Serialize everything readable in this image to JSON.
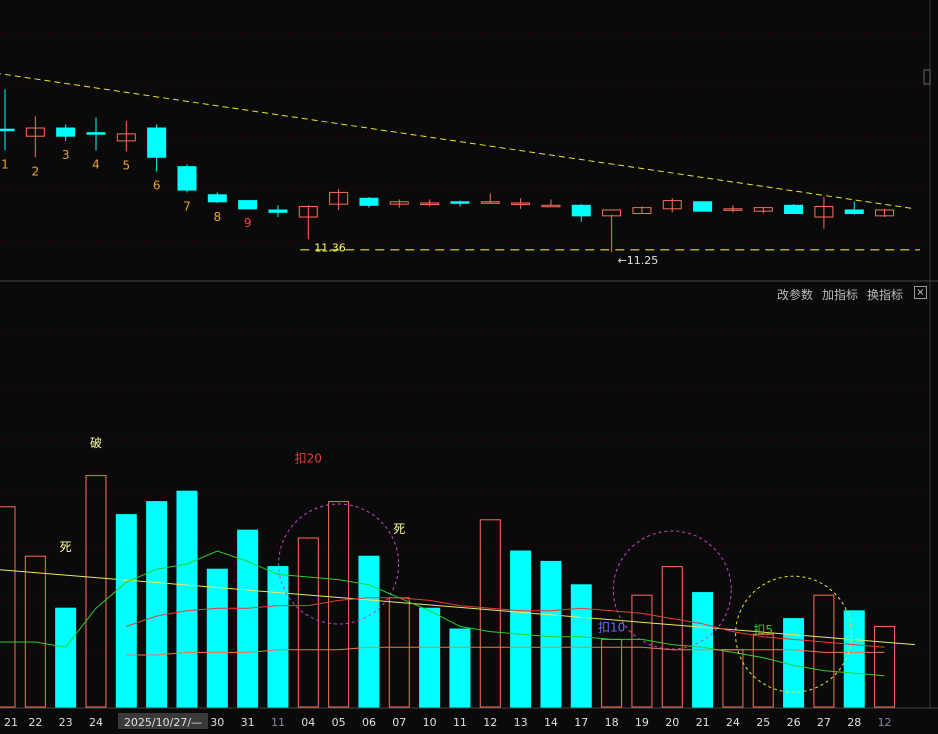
{
  "toolbar": {
    "params_label": "改参数",
    "add_indicator_label": "加指标",
    "switch_indicator_label": "换指标",
    "close_symbol": "×"
  },
  "colors": {
    "background": "#0a0a0a",
    "up": "#ff6f5b",
    "down": "#00ffff",
    "trendline_price": "#e6e62e",
    "trendline_volume": "#e8e860",
    "ma_green": "#2ecc2e",
    "ma_red": "#e63c3c",
    "ma_orange": "#e67a50",
    "grid": "#3a0000"
  },
  "chart_data": [
    {
      "type": "candlestick",
      "panel": "price",
      "candles": [
        {
          "o": 12.3,
          "h": 12.64,
          "l": 12.12,
          "c": 12.29
        },
        {
          "o": 12.24,
          "h": 12.41,
          "l": 12.06,
          "c": 12.31
        },
        {
          "o": 12.31,
          "h": 12.34,
          "l": 12.2,
          "c": 12.24
        },
        {
          "o": 12.27,
          "h": 12.4,
          "l": 12.12,
          "c": 12.26
        },
        {
          "o": 12.2,
          "h": 12.37,
          "l": 12.11,
          "c": 12.26
        },
        {
          "o": 12.31,
          "h": 12.34,
          "l": 11.94,
          "c": 12.06
        },
        {
          "o": 11.98,
          "h": 12.0,
          "l": 11.76,
          "c": 11.78
        },
        {
          "o": 11.74,
          "h": 11.76,
          "l": 11.67,
          "c": 11.68
        },
        {
          "o": 11.69,
          "h": 11.69,
          "l": 11.62,
          "c": 11.62
        },
        {
          "o": 11.61,
          "h": 11.65,
          "l": 11.55,
          "c": 11.59
        },
        {
          "o": 11.55,
          "h": 11.65,
          "l": 11.36,
          "c": 11.64
        },
        {
          "o": 11.66,
          "h": 11.79,
          "l": 11.61,
          "c": 11.76
        },
        {
          "o": 11.71,
          "h": 11.72,
          "l": 11.63,
          "c": 11.65
        },
        {
          "o": 11.66,
          "h": 11.7,
          "l": 11.63,
          "c": 11.68
        },
        {
          "o": 11.66,
          "h": 11.7,
          "l": 11.64,
          "c": 11.67
        },
        {
          "o": 11.68,
          "h": 11.69,
          "l": 11.64,
          "c": 11.67
        },
        {
          "o": 11.68,
          "h": 11.75,
          "l": 11.67,
          "c": 11.68
        },
        {
          "o": 11.67,
          "h": 11.71,
          "l": 11.62,
          "c": 11.67
        },
        {
          "o": 11.65,
          "h": 11.7,
          "l": 11.65,
          "c": 11.65
        },
        {
          "o": 11.65,
          "h": 11.66,
          "l": 11.51,
          "c": 11.56
        },
        {
          "o": 11.56,
          "h": 11.57,
          "l": 11.25,
          "c": 11.61
        },
        {
          "o": 11.58,
          "h": 11.64,
          "l": 11.58,
          "c": 11.63
        },
        {
          "o": 11.62,
          "h": 11.71,
          "l": 11.59,
          "c": 11.69
        },
        {
          "o": 11.68,
          "h": 11.68,
          "l": 11.6,
          "c": 11.6
        },
        {
          "o": 11.62,
          "h": 11.65,
          "l": 11.59,
          "c": 11.62
        },
        {
          "o": 11.6,
          "h": 11.63,
          "l": 11.58,
          "c": 11.63
        },
        {
          "o": 11.65,
          "h": 11.66,
          "l": 11.58,
          "c": 11.58
        },
        {
          "o": 11.55,
          "h": 11.72,
          "l": 11.45,
          "c": 11.64
        },
        {
          "o": 11.61,
          "h": 11.68,
          "l": 11.57,
          "c": 11.58
        },
        {
          "o": 11.56,
          "h": 11.62,
          "l": 11.55,
          "c": 11.61
        }
      ],
      "trendline": [
        [
          0,
          12.78
        ],
        [
          30,
          11.62
        ]
      ],
      "support": {
        "from": 10,
        "to": 30,
        "value": 11.27
      },
      "count_labels": [
        {
          "index": 0,
          "text": "1"
        },
        {
          "index": 1,
          "text": "2"
        },
        {
          "index": 2,
          "text": "3"
        },
        {
          "index": 3,
          "text": "4"
        },
        {
          "index": 4,
          "text": "5"
        },
        {
          "index": 5,
          "text": "6"
        },
        {
          "index": 6,
          "text": "7"
        },
        {
          "index": 7,
          "text": "8"
        },
        {
          "index": 8,
          "text": "9"
        }
      ],
      "annotations": [
        {
          "index": 10,
          "value": 11.36,
          "text": "11.36"
        },
        {
          "index": 20,
          "value": 11.25,
          "text": "←11.25"
        }
      ]
    },
    {
      "type": "bar",
      "panel": "volume",
      "dates": [
        "21",
        "22",
        "23",
        "24",
        "2025/10/27/—",
        "30",
        "31",
        "11",
        "04",
        "05",
        "06",
        "07",
        "10",
        "11",
        "12",
        "13",
        "14",
        "17",
        "18",
        "19",
        "20",
        "21",
        "24",
        "25",
        "26",
        "27",
        "28",
        "12"
      ],
      "volumes": [
        77,
        58,
        38,
        89,
        74,
        79,
        83,
        53,
        68,
        54,
        65,
        79,
        58,
        42,
        38,
        30,
        72,
        60,
        56,
        47,
        26,
        43,
        54,
        44,
        22,
        28,
        34,
        43,
        37,
        31
      ],
      "direction": [
        "up",
        "up",
        "down",
        "up",
        "down",
        "down",
        "down",
        "down",
        "down",
        "down",
        "up",
        "up",
        "down",
        "up",
        "down",
        "down",
        "up",
        "down",
        "down",
        "down",
        "up",
        "up",
        "up",
        "down",
        "up",
        "up",
        "down",
        "up",
        "down",
        "up"
      ],
      "trendline": [
        [
          0,
          52
        ],
        [
          30,
          24
        ]
      ],
      "ma_lines": [
        {
          "color": "green",
          "values": [
            25,
            25,
            23,
            38,
            48,
            53,
            55,
            60,
            56,
            51,
            50,
            49,
            47,
            42,
            37,
            31,
            29,
            28,
            27,
            27,
            26,
            26,
            24,
            23,
            21,
            19,
            16,
            14,
            13,
            12
          ]
        },
        {
          "color": "red",
          "values": [
            null,
            null,
            null,
            null,
            31,
            35,
            37,
            38,
            38,
            39,
            39,
            41,
            42,
            42,
            41,
            39,
            38,
            37,
            37,
            38,
            37,
            36,
            34,
            32,
            29,
            27,
            26,
            25,
            24,
            23
          ]
        },
        {
          "color": "orange",
          "values": [
            null,
            null,
            null,
            null,
            20,
            20,
            21,
            21,
            21,
            22,
            22,
            22,
            23,
            23,
            23,
            23,
            23,
            23,
            23,
            23,
            23,
            23,
            22,
            22,
            22,
            22,
            22,
            21,
            21,
            21
          ]
        }
      ],
      "labels": [
        {
          "index": 3,
          "value": 100,
          "text": "破",
          "color": "#ffffa0"
        },
        {
          "index": 10,
          "value": 94,
          "text": "扣20",
          "color": "#e63c3c"
        },
        {
          "index": 2,
          "value": 60,
          "text": "死",
          "color": "#ffffa0"
        },
        {
          "index": 13,
          "value": 67,
          "text": "死",
          "color": "#ffffa0"
        },
        {
          "index": 20,
          "value": 29,
          "text": "扣10",
          "color": "#6a6aff"
        },
        {
          "index": 25,
          "value": 28,
          "text": "扣5",
          "color": "#2ecc2e"
        }
      ],
      "circles": [
        {
          "index": 11,
          "value": 55,
          "r": 60,
          "color": "#cc44cc"
        },
        {
          "index": 22,
          "value": 45,
          "r": 59,
          "color": "#cc44cc"
        },
        {
          "index": 26,
          "value": 28,
          "r": 58,
          "color": "#e6e62e"
        }
      ]
    }
  ]
}
